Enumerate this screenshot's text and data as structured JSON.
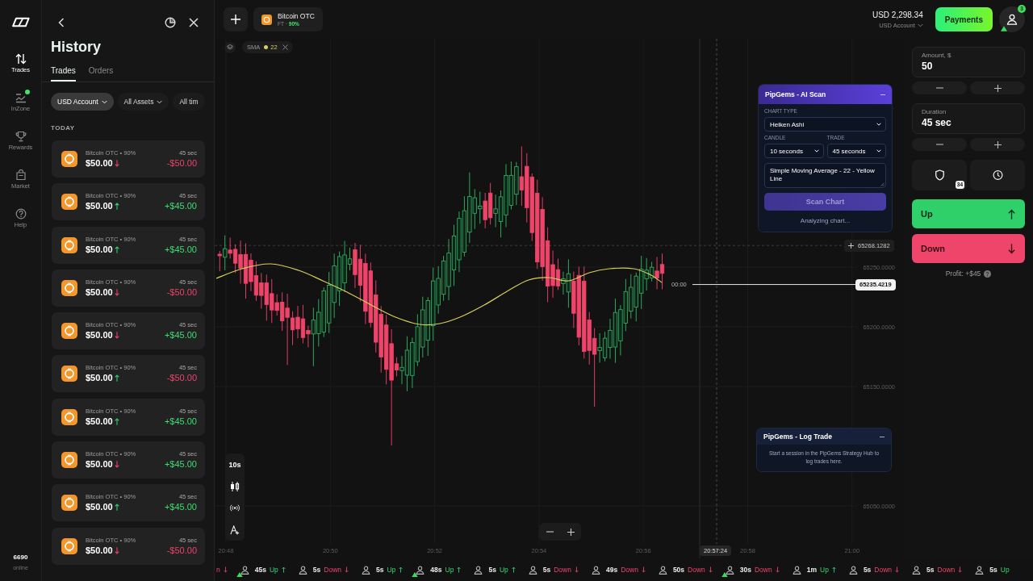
{
  "sidebar": {
    "items": [
      {
        "label": "Trades",
        "selected": true,
        "notification": false
      },
      {
        "label": "InZone",
        "selected": false,
        "notification": true
      },
      {
        "label": "Rewards",
        "selected": false,
        "notification": false
      },
      {
        "label": "Market",
        "selected": false,
        "notification": false
      },
      {
        "label": "Help",
        "selected": false,
        "notification": false
      }
    ],
    "online": {
      "count": "6690",
      "label": "online"
    }
  },
  "history": {
    "title": "History",
    "tabs": [
      {
        "label": "Trades",
        "selected": true
      },
      {
        "label": "Orders",
        "selected": false
      }
    ],
    "filters": [
      {
        "label": "USD Account",
        "selected": true,
        "dropdown": true
      },
      {
        "label": "All Assets",
        "selected": false,
        "dropdown": true
      },
      {
        "label": "All tim",
        "selected": false,
        "dropdown": false
      }
    ],
    "group_label": "TODAY",
    "trades": [
      {
        "asset": "Bitcoin OTC • 90%",
        "amount": "$50.00",
        "up": false,
        "duration": "45 sec",
        "profit": "-$50.00",
        "won": false
      },
      {
        "asset": "Bitcoin OTC • 90%",
        "amount": "$50.00",
        "up": true,
        "duration": "45 sec",
        "profit": "+$45.00",
        "won": true
      },
      {
        "asset": "Bitcoin OTC • 90%",
        "amount": "$50.00",
        "up": true,
        "duration": "45 sec",
        "profit": "+$45.00",
        "won": true
      },
      {
        "asset": "Bitcoin OTC • 90%",
        "amount": "$50.00",
        "up": false,
        "duration": "45 sec",
        "profit": "-$50.00",
        "won": false
      },
      {
        "asset": "Bitcoin OTC • 90%",
        "amount": "$50.00",
        "up": false,
        "duration": "45 sec",
        "profit": "+$45.00",
        "won": true
      },
      {
        "asset": "Bitcoin OTC • 90%",
        "amount": "$50.00",
        "up": true,
        "duration": "45 sec",
        "profit": "-$50.00",
        "won": false
      },
      {
        "asset": "Bitcoin OTC • 90%",
        "amount": "$50.00",
        "up": true,
        "duration": "45 sec",
        "profit": "+$45.00",
        "won": true
      },
      {
        "asset": "Bitcoin OTC • 90%",
        "amount": "$50.00",
        "up": false,
        "duration": "45 sec",
        "profit": "+$45.00",
        "won": true
      },
      {
        "asset": "Bitcoin OTC • 90%",
        "amount": "$50.00",
        "up": true,
        "duration": "45 sec",
        "profit": "+$45.00",
        "won": true
      },
      {
        "asset": "Bitcoin OTC • 90%",
        "amount": "$50.00",
        "up": false,
        "duration": "45 sec",
        "profit": "-$50.00",
        "won": false
      }
    ]
  },
  "header": {
    "asset": {
      "name": "Bitcoin OTC",
      "market": "FT ·",
      "payout": "90%"
    },
    "account": {
      "balance": "USD 2,298.34",
      "name": "USD Account"
    },
    "payments": "Payments",
    "notifications": "3"
  },
  "chart": {
    "indicators": [
      {
        "name": "SMA",
        "period": "22",
        "color": "#d8d05a"
      }
    ],
    "price_labels": [
      "65250.0000",
      "65200.0000",
      "65150.0000",
      "65050.0000"
    ],
    "time_labels": [
      "20:48",
      "20:50",
      "20:52",
      "20:54",
      "20:56",
      "20:58",
      "21:00"
    ],
    "crosshair": {
      "price": "65268.1282",
      "time": "20:57:24"
    },
    "current_price": "65235.4219",
    "countdown": "00:00",
    "timeframe": "10s"
  },
  "ai_scan": {
    "title": "PipGems - AI Scan",
    "chart_type": {
      "label": "CHART TYPE",
      "value": "Heiken Ashi"
    },
    "candle": {
      "label": "CANDLE",
      "value": "10 seconds"
    },
    "trade": {
      "label": "TRADE",
      "value": "45 seconds"
    },
    "notes": "Simple Moving Average - 22 - Yellow Line",
    "button": {
      "label": "Scan Chart",
      "disabled": true
    },
    "status": "Analyzing chart..."
  },
  "log_trade": {
    "title": "PipGems - Log Trade",
    "message": "Start a session in the PipGems Strategy Hub to log trades here."
  },
  "trade_panel": {
    "amount": {
      "label": "Amount, $",
      "value": "50"
    },
    "duration": {
      "label": "Duration",
      "value": "45 sec"
    },
    "pending_count": "34",
    "up_button": {
      "label": "Up"
    },
    "down_button": {
      "label": "Down"
    },
    "profit": "Profit: +$45"
  },
  "ticker": [
    {
      "label": "n",
      "up": false,
      "avatar": false,
      "arrow": true
    },
    {
      "duration": "45s",
      "label": "Up",
      "up": true,
      "avatar": true,
      "marked": true,
      "arrow": true
    },
    {
      "duration": "5s",
      "label": "Down",
      "up": false,
      "avatar": true,
      "marked": false,
      "arrow": true
    },
    {
      "duration": "5s",
      "label": "Up",
      "up": true,
      "avatar": true,
      "marked": false,
      "arrow": true
    },
    {
      "duration": "48s",
      "label": "Up",
      "up": true,
      "avatar": true,
      "marked": true,
      "arrow": true
    },
    {
      "duration": "5s",
      "label": "Up",
      "up": true,
      "avatar": true,
      "marked": false,
      "arrow": true
    },
    {
      "duration": "5s",
      "label": "Down",
      "up": false,
      "avatar": true,
      "marked": false,
      "arrow": true
    },
    {
      "duration": "49s",
      "label": "Down",
      "up": false,
      "avatar": true,
      "marked": false,
      "arrow": true
    },
    {
      "duration": "50s",
      "label": "Down",
      "up": false,
      "avatar": true,
      "marked": false,
      "arrow": true
    },
    {
      "duration": "30s",
      "label": "Down",
      "up": false,
      "avatar": true,
      "marked": true,
      "arrow": true
    },
    {
      "duration": "1m",
      "label": "Up",
      "up": true,
      "avatar": true,
      "marked": false,
      "arrow": true
    },
    {
      "duration": "5s",
      "label": "Down",
      "up": false,
      "avatar": true,
      "marked": false,
      "arrow": true
    },
    {
      "duration": "5s",
      "label": "Down",
      "up": false,
      "avatar": true,
      "marked": false,
      "arrow": true
    },
    {
      "duration": "5s",
      "label": "Up",
      "up": true,
      "avatar": true,
      "marked": false,
      "arrow": false
    }
  ]
}
